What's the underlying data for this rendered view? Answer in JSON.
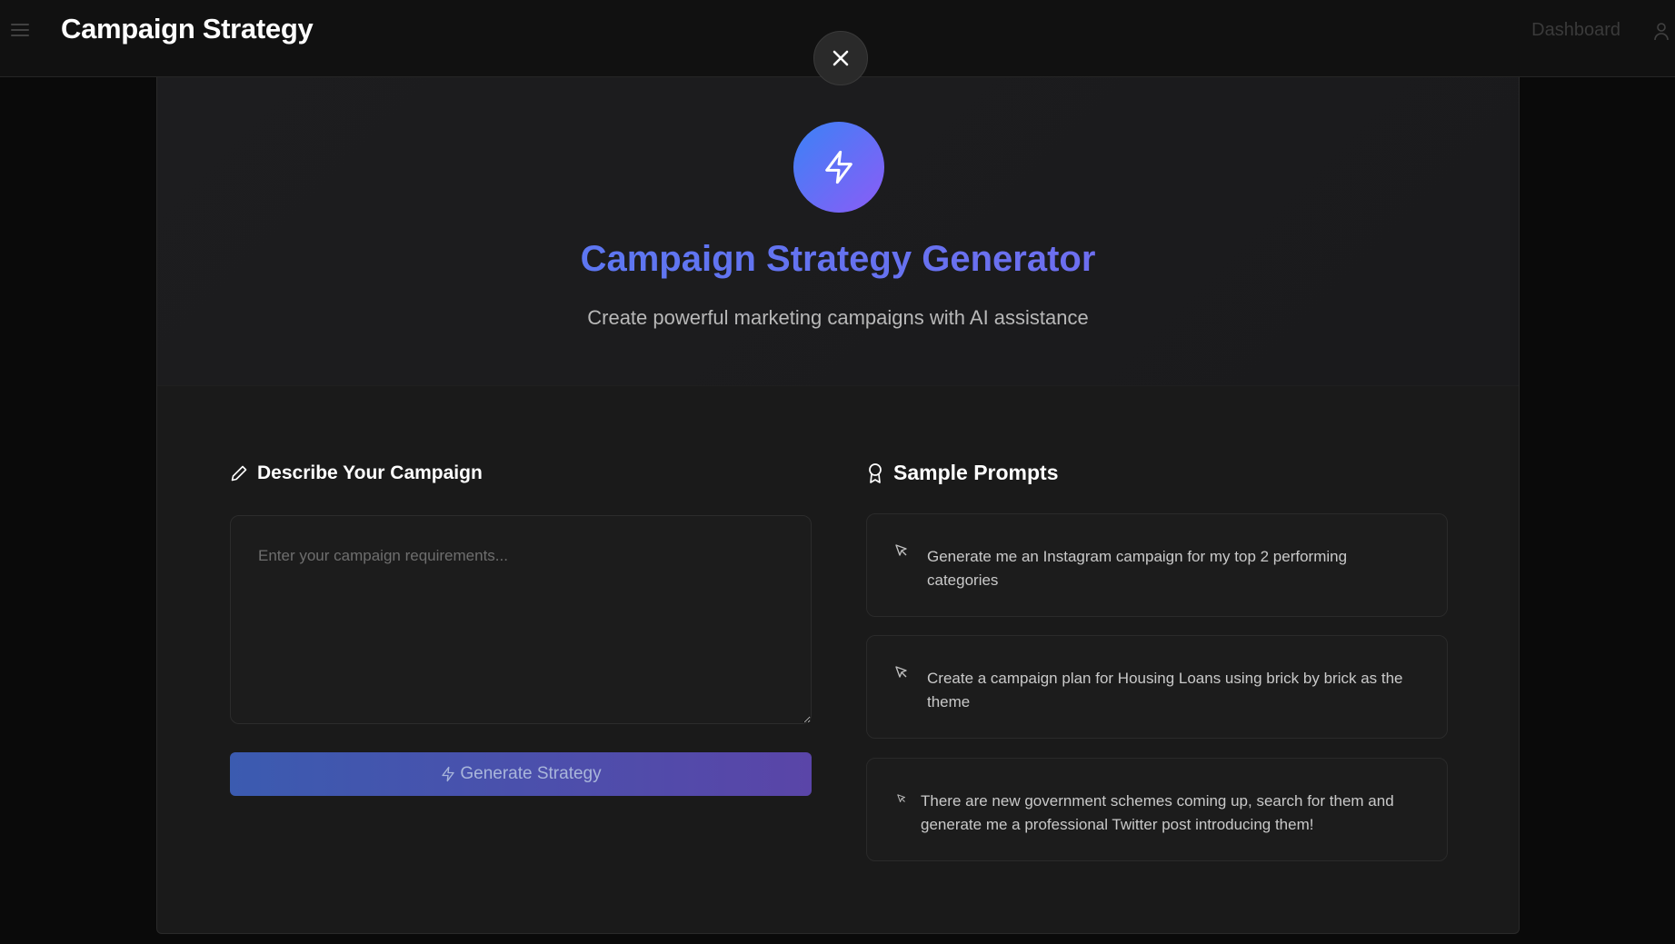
{
  "header": {
    "title": "Campaign Strategy",
    "nav_dashboard": "Dashboard"
  },
  "hero": {
    "icon": "lightning-bolt-icon",
    "title": "Campaign Strategy Generator",
    "subtitle": "Create powerful marketing campaigns with AI assistance"
  },
  "form": {
    "section_label": "Describe Your Campaign",
    "textarea_value": "",
    "textarea_placeholder": "Enter your campaign requirements...",
    "generate_label": "Generate Strategy"
  },
  "samples": {
    "section_label": "Sample Prompts",
    "items": [
      {
        "text": "Generate me an Instagram campaign for my top 2 performing categories"
      },
      {
        "text": "Create a campaign plan for Housing Loans using brick by brick as the theme"
      },
      {
        "text": "There are new government schemes coming up, search for them and generate me a professional Twitter post introducing them!"
      }
    ]
  },
  "colors": {
    "accent_start": "#3b82f6",
    "accent_end": "#8b5cf6",
    "background": "#0a0a0a",
    "panel": "#1a1a1a"
  }
}
